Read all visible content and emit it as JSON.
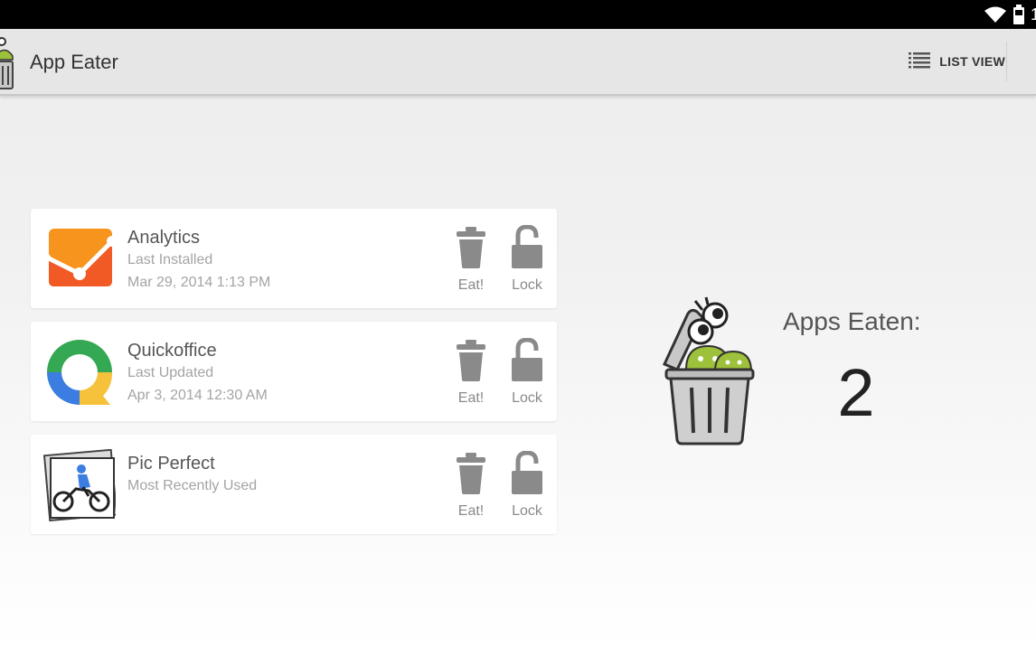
{
  "status_bar": {
    "clock": "1",
    "icons": [
      "wifi-icon",
      "battery-icon"
    ]
  },
  "action_bar": {
    "title": "App Eater",
    "list_view_label": "LIST VIEW",
    "icons": [
      "app-logo",
      "list-icon"
    ]
  },
  "apps": [
    {
      "name": "Analytics",
      "subtitle": "Last Installed",
      "date": "Mar 29, 2014 1:13 PM",
      "icon": "analytics-icon",
      "eat_label": "Eat!",
      "lock_label": "Lock"
    },
    {
      "name": "Quickoffice",
      "subtitle": "Last Updated",
      "date": "Apr 3, 2014 12:30 AM",
      "icon": "quickoffice-icon",
      "eat_label": "Eat!",
      "lock_label": "Lock"
    },
    {
      "name": "Pic Perfect",
      "subtitle": "Most Recently Used",
      "date": "",
      "icon": "pic-perfect-icon",
      "eat_label": "Eat!",
      "lock_label": "Lock"
    }
  ],
  "stats": {
    "label": "Apps Eaten:",
    "count": "2",
    "icon": "trash-mascot-icon"
  },
  "colors": {
    "action_bar": "#e6e6e6",
    "card_background": "#ffffff",
    "action_icon": "#8a8a8a",
    "analytics_orange": "#f15a24",
    "quickoffice_blue": "#3b7de0",
    "quickoffice_green": "#35a853",
    "quickoffice_yellow": "#f6c13b",
    "android_green": "#9dc13a"
  }
}
